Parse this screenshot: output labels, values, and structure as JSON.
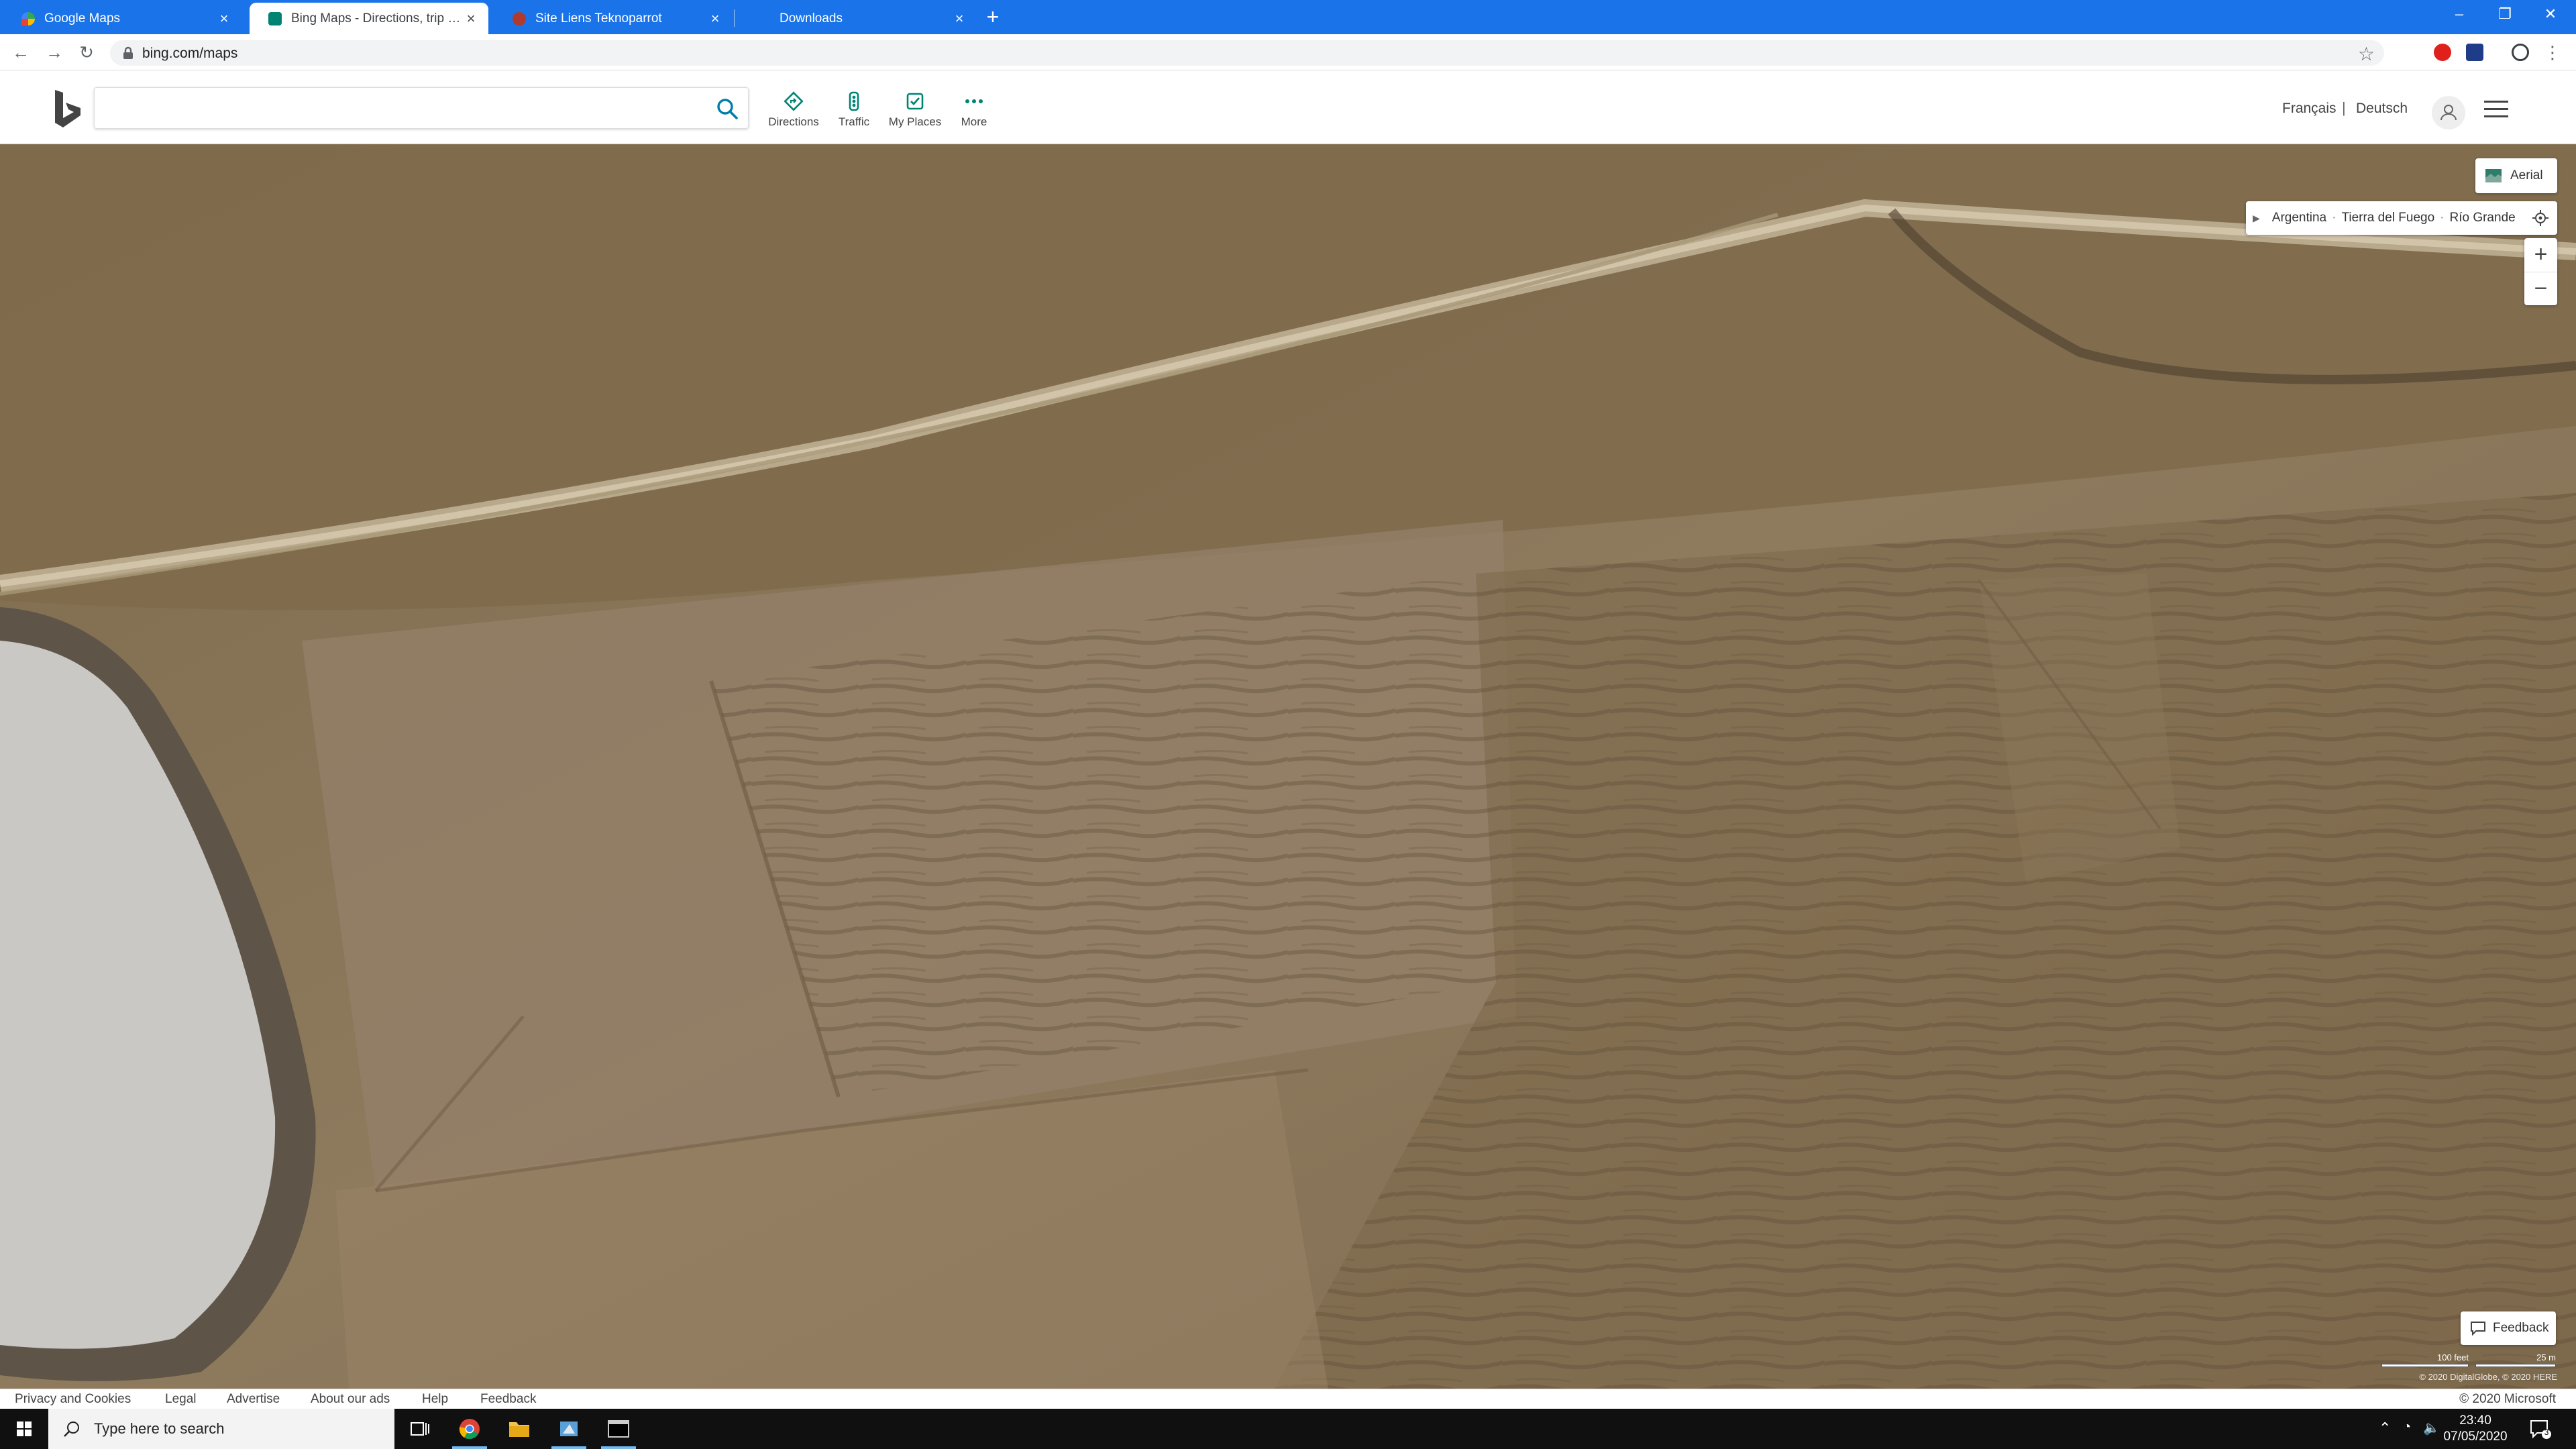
{
  "browser": {
    "tabs": [
      {
        "title": "Google Maps",
        "active": false
      },
      {
        "title": "Bing Maps - Directions, trip planning, traffic cameras & more",
        "active": true
      },
      {
        "title": "Site Liens Teknoparrot",
        "active": false
      },
      {
        "title": "Downloads",
        "active": false
      }
    ],
    "new_tab": "+",
    "close_glyph": "×",
    "url": "bing.com/maps"
  },
  "bing": {
    "search_value": "",
    "nav": [
      {
        "label": "Directions",
        "icon": "directions-icon"
      },
      {
        "label": "Traffic",
        "icon": "traffic-icon"
      },
      {
        "label": "My Places",
        "icon": "my-places-icon"
      },
      {
        "label": "More",
        "icon": "more-icon"
      }
    ],
    "languages": [
      "Français",
      "Deutsch"
    ],
    "lang_sep": "|"
  },
  "map": {
    "view_label": "Aerial",
    "breadcrumb": [
      "Argentina",
      "Tierra del Fuego",
      "Río Grande"
    ],
    "breadcrumb_sep": "·",
    "zoom_in": "+",
    "zoom_out": "−",
    "feedback_label": "Feedback",
    "scale_imperial": "100 feet",
    "scale_metric": "25 m",
    "imagery_copyright": "© 2020 DigitalGlobe, © 2020 HERE"
  },
  "footer": {
    "links": [
      "Privacy and Cookies",
      "Legal",
      "Advertise",
      "About our ads",
      "Help",
      "Feedback"
    ],
    "copyright": "© 2020 Microsoft"
  },
  "taskbar": {
    "search_placeholder": "Type here to search",
    "time": "23:40",
    "date": "07/05/2020",
    "notification_count": "3"
  },
  "colors": {
    "chrome_blue": "#1a73e8",
    "bing_teal": "#008373",
    "taskbar": "#101010",
    "terrain": "#8a7558",
    "water": "#c9c8c4"
  }
}
